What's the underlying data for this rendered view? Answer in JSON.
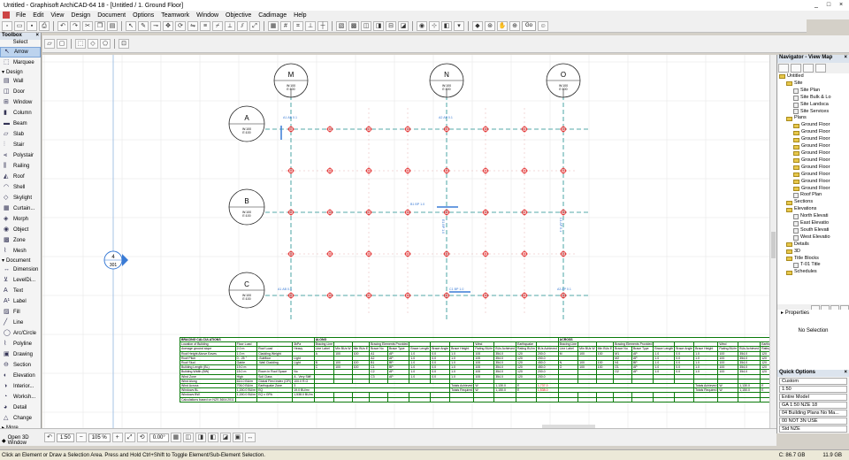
{
  "window": {
    "title": "Untitled - Graphisoft ArchiCAD-64 18 - [Untitled / 1. Ground Floor]",
    "controls": [
      "_",
      "□",
      "×"
    ]
  },
  "menu": [
    "File",
    "Edit",
    "View",
    "Design",
    "Document",
    "Options",
    "Teamwork",
    "Window",
    "Objective",
    "Cadimage",
    "Help"
  ],
  "toolbar": {
    "go_label": "Go"
  },
  "toolbox": {
    "title": "Toolbox",
    "select_label": "Select",
    "arrow": "Arrow",
    "marquee": "Marquee",
    "design_section": "Design",
    "design_tools": [
      "Wall",
      "Door",
      "Window",
      "Column",
      "Beam",
      "Slab",
      "Stair",
      "Polystair",
      "Railing",
      "Roof",
      "Shell",
      "Skylight",
      "Curtain...",
      "Morph",
      "Object",
      "Zone",
      "Mesh"
    ],
    "document_section": "Document",
    "document_tools": [
      "Dimension",
      "LevelDi...",
      "Text",
      "Label",
      "Fill",
      "Line",
      "Arc/Circle",
      "Polyline",
      "Drawing",
      "Section",
      "Elevation",
      "Interior...",
      "Worksh...",
      "Detail",
      "Change"
    ],
    "more": "More"
  },
  "drawing": {
    "grid_columns": [
      {
        "label": "M",
        "sub1": "W:100",
        "sub2": "E:100"
      },
      {
        "label": "N",
        "sub1": "W:100",
        "sub2": "E:100"
      },
      {
        "label": "O",
        "sub1": "W:100",
        "sub2": "E:100"
      }
    ],
    "grid_rows": [
      {
        "label": "A",
        "sub1": "W:100",
        "sub2": "E:100"
      },
      {
        "label": "B",
        "sub1": "W:100",
        "sub2": "E:100"
      },
      {
        "label": "C",
        "sub1": "W:100",
        "sub2": "E:100"
      }
    ],
    "section_marker": {
      "top": "4",
      "bottom": "301"
    },
    "brace_labels": [
      "A1 AB 0.1",
      "A2 AP 0.1",
      "B1 BP 1.0",
      "C1 BP 1.0",
      "E1 BP 1.0",
      "C1 AP 0.1",
      "A1 AB 0.1",
      "A3 AP 0.1"
    ],
    "accent": "#3a7bd5",
    "grid_line_color": "#1e8f8f",
    "node_color": "#e02020"
  },
  "calc": {
    "title": "BRACING CALCULATIONS",
    "along": "ALONG",
    "across": "ACROSS",
    "left_rows": [
      [
        "Location of Building",
        "Floor Load",
        "",
        "3kPa"
      ],
      [
        "Average ground slope",
        "2.0 m",
        "Roof Load",
        "Heavy"
      ],
      [
        "Roof Height Above Eaves",
        "1.0 m",
        "Cladding Weight",
        ""
      ],
      [
        "Roof Pitch",
        "0 - 25 °",
        "-Subfloor",
        "Light"
      ],
      [
        "Roof Stud",
        "Gable",
        "-Wall Cladding",
        "Light"
      ],
      [
        "Building Length (BL)",
        "19.0 m",
        "",
        ""
      ],
      [
        "Building Width (BW)",
        "15.0 m",
        "Room in Roof Space",
        "No"
      ],
      [
        "Wind Zone",
        "High",
        "Soil Class",
        "A - Very Stiff"
      ],
      [
        "Wind Along",
        "614.0 BU/m",
        "Global Flexi Index (GFI)",
        "100.0 R.G"
      ],
      [
        "Wind Across",
        "706.0 BU/m",
        "Earthquake Zone",
        "3"
      ],
      [
        "Windows BL",
        "1,150.0 BU/m",
        "EQ",
        "19.0 BU/m²"
      ],
      [
        "Windows BW",
        "1,150.0 BU/m",
        "EQ x GPA",
        "1,538.0 BU/m"
      ],
      [
        "Calculations based on NZS 3604:2011",
        "",
        "",
        ""
      ]
    ],
    "head1": [
      "Bracing Line",
      "",
      "",
      "Bracing Elements Provided",
      "",
      "",
      "",
      "Wind",
      "",
      "Earthquake",
      ""
    ],
    "head2": [
      "Line Label",
      "Min BUs W",
      "Min BUs E",
      "Brace No",
      "Brace Type",
      "Brace Length",
      "Brace Angle",
      "Brace Height",
      "Rating BU/m",
      "BUs Achieved",
      "Rating BU/m",
      "BUs Achieved"
    ],
    "along_rows": [
      [
        "A",
        "100",
        "100",
        "A1",
        "AP",
        "1.0",
        "0.0",
        "1.0",
        "100",
        "354.0",
        "120",
        "200.0"
      ],
      [
        "",
        "",
        "",
        "A2",
        "AP",
        "1.0",
        "0.0",
        "1.0",
        "100",
        "354.0",
        "120",
        "200.0"
      ],
      [
        "B",
        "100",
        "100",
        "B1",
        "BP",
        "1.0",
        "0.0",
        "1.0",
        "100",
        "354.0",
        "120",
        "450.0"
      ],
      [
        "C",
        "100",
        "100",
        "C1",
        "BP",
        "1.0",
        "0.0",
        "1.0",
        "100",
        "354.0",
        "120",
        "450.0"
      ],
      [
        "",
        "",
        "",
        "C2",
        "AP",
        "1.0",
        "0.0",
        "1.0",
        "100",
        "354.0",
        "120",
        "200.0"
      ],
      [
        "",
        "",
        "",
        "C3",
        "AP",
        "1.0",
        "0.0",
        "1.0",
        "100",
        "354.0",
        "120",
        "200.0"
      ]
    ],
    "across_rows": [
      [
        "M",
        "100",
        "100",
        "M1",
        "AP",
        "1.0",
        "0.0",
        "1.0",
        "100",
        "354.0",
        "120",
        "200.0"
      ],
      [
        "",
        "",
        "",
        "M2",
        "AP",
        "1.0",
        "0.0",
        "1.0",
        "100",
        "354.0",
        "120",
        "200.0"
      ],
      [
        "N",
        "100",
        "100",
        "N1",
        "BP",
        "1.0",
        "0.0",
        "1.0",
        "100",
        "354.0",
        "120",
        "450.0"
      ],
      [
        "O",
        "100",
        "100",
        "O1",
        "AP",
        "1.0",
        "0.0",
        "1.0",
        "100",
        "354.0",
        "120",
        "200.0"
      ],
      [
        "",
        "",
        "",
        "O2",
        "AP",
        "1.0",
        "0.0",
        "1.0",
        "100",
        "354.0",
        "120",
        "200.0"
      ],
      [
        "",
        "",
        "",
        "",
        "",
        "",
        "",
        "",
        "",
        "",
        "",
        ""
      ]
    ],
    "totals_achieved": "Totals Achieved",
    "totals_required": "Totals Required",
    "along_tot": {
      "w_label": "W",
      "w": "1,130.0",
      "e_label": "E",
      "e": "1,737.0"
    },
    "along_req": {
      "w_label": "W",
      "w": "1,150.0",
      "e_label": "E",
      "e": "1,538.0"
    },
    "across_tot": {
      "w_label": "W",
      "w": "1,130.0",
      "e_label": "E",
      "e": "977.0"
    },
    "across_req": {
      "w_label": "W",
      "w": "1,150.0",
      "e_label": "E",
      "e": "1,538.0"
    }
  },
  "navigator": {
    "title": "Navigator - View Map",
    "tree": [
      {
        "lvl": 0,
        "t": "folder",
        "label": "Untitled"
      },
      {
        "lvl": 1,
        "t": "folder",
        "label": "Site"
      },
      {
        "lvl": 2,
        "t": "page",
        "label": "Site Plan"
      },
      {
        "lvl": 2,
        "t": "page",
        "label": "Site Bulk & Lo"
      },
      {
        "lvl": 2,
        "t": "page",
        "label": "Site Landsca"
      },
      {
        "lvl": 2,
        "t": "page",
        "label": "Site Services"
      },
      {
        "lvl": 1,
        "t": "folder",
        "label": "Plans"
      },
      {
        "lvl": 2,
        "t": "folder",
        "label": "Ground Floor"
      },
      {
        "lvl": 2,
        "t": "folder",
        "label": "Ground Floor"
      },
      {
        "lvl": 2,
        "t": "folder",
        "label": "Ground Floor"
      },
      {
        "lvl": 2,
        "t": "folder",
        "label": "Ground Floor"
      },
      {
        "lvl": 2,
        "t": "folder",
        "label": "Ground Floor"
      },
      {
        "lvl": 2,
        "t": "folder",
        "label": "Ground Floor"
      },
      {
        "lvl": 2,
        "t": "folder",
        "label": "Ground Floor"
      },
      {
        "lvl": 2,
        "t": "folder",
        "label": "Ground Floor"
      },
      {
        "lvl": 2,
        "t": "folder",
        "label": "Ground Floor"
      },
      {
        "lvl": 2,
        "t": "folder",
        "label": "Ground Floor"
      },
      {
        "lvl": 2,
        "t": "page",
        "label": "Roof Plan"
      },
      {
        "lvl": 1,
        "t": "folder",
        "label": "Sections"
      },
      {
        "lvl": 1,
        "t": "folder",
        "label": "Elevations"
      },
      {
        "lvl": 2,
        "t": "page",
        "label": "North Elevati"
      },
      {
        "lvl": 2,
        "t": "page",
        "label": "East Elevatio"
      },
      {
        "lvl": 2,
        "t": "page",
        "label": "South Elevati"
      },
      {
        "lvl": 2,
        "t": "page",
        "label": "West Elevatio"
      },
      {
        "lvl": 1,
        "t": "folder",
        "label": "Details"
      },
      {
        "lvl": 1,
        "t": "folder",
        "label": "3D"
      },
      {
        "lvl": 1,
        "t": "folder",
        "label": "Title Blocks"
      },
      {
        "lvl": 2,
        "t": "page",
        "label": "T-01 Title"
      },
      {
        "lvl": 1,
        "t": "folder",
        "label": "Schedules"
      }
    ]
  },
  "properties": {
    "title": "Properties",
    "value": "No Selection"
  },
  "quick": {
    "title": "Quick Options",
    "items": [
      "Custom",
      "1:50",
      "Entire Model",
      "GA 1:50 NZE 18",
      "04 Building Plans No Ma...",
      "00 NOT 3N USE",
      "Std NZE"
    ]
  },
  "bottom": {
    "open3d": "Open 3D Window",
    "scale": "1:50",
    "zoom": "105 %",
    "angle": "0.00°"
  },
  "status": {
    "hint": "Click an Element or Draw a Selection Area. Press and Hold Ctrl+Shift to Toggle Element/Sub-Element Selection.",
    "disk1": "C: 86.7 GB",
    "disk2": "11.9 GB"
  }
}
